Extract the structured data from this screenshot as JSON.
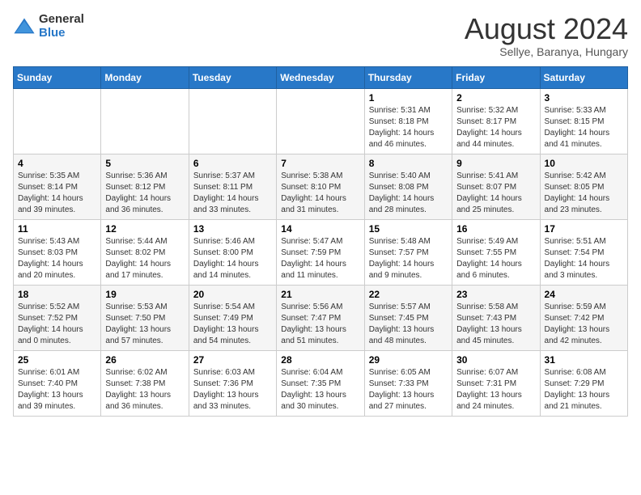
{
  "header": {
    "logo_general": "General",
    "logo_blue": "Blue",
    "title": "August 2024",
    "subtitle": "Sellye, Baranya, Hungary"
  },
  "calendar": {
    "days_of_week": [
      "Sunday",
      "Monday",
      "Tuesday",
      "Wednesday",
      "Thursday",
      "Friday",
      "Saturday"
    ],
    "weeks": [
      [
        {
          "day": "",
          "info": ""
        },
        {
          "day": "",
          "info": ""
        },
        {
          "day": "",
          "info": ""
        },
        {
          "day": "",
          "info": ""
        },
        {
          "day": "1",
          "info": "Sunrise: 5:31 AM\nSunset: 8:18 PM\nDaylight: 14 hours and 46 minutes."
        },
        {
          "day": "2",
          "info": "Sunrise: 5:32 AM\nSunset: 8:17 PM\nDaylight: 14 hours and 44 minutes."
        },
        {
          "day": "3",
          "info": "Sunrise: 5:33 AM\nSunset: 8:15 PM\nDaylight: 14 hours and 41 minutes."
        }
      ],
      [
        {
          "day": "4",
          "info": "Sunrise: 5:35 AM\nSunset: 8:14 PM\nDaylight: 14 hours and 39 minutes."
        },
        {
          "day": "5",
          "info": "Sunrise: 5:36 AM\nSunset: 8:12 PM\nDaylight: 14 hours and 36 minutes."
        },
        {
          "day": "6",
          "info": "Sunrise: 5:37 AM\nSunset: 8:11 PM\nDaylight: 14 hours and 33 minutes."
        },
        {
          "day": "7",
          "info": "Sunrise: 5:38 AM\nSunset: 8:10 PM\nDaylight: 14 hours and 31 minutes."
        },
        {
          "day": "8",
          "info": "Sunrise: 5:40 AM\nSunset: 8:08 PM\nDaylight: 14 hours and 28 minutes."
        },
        {
          "day": "9",
          "info": "Sunrise: 5:41 AM\nSunset: 8:07 PM\nDaylight: 14 hours and 25 minutes."
        },
        {
          "day": "10",
          "info": "Sunrise: 5:42 AM\nSunset: 8:05 PM\nDaylight: 14 hours and 23 minutes."
        }
      ],
      [
        {
          "day": "11",
          "info": "Sunrise: 5:43 AM\nSunset: 8:03 PM\nDaylight: 14 hours and 20 minutes."
        },
        {
          "day": "12",
          "info": "Sunrise: 5:44 AM\nSunset: 8:02 PM\nDaylight: 14 hours and 17 minutes."
        },
        {
          "day": "13",
          "info": "Sunrise: 5:46 AM\nSunset: 8:00 PM\nDaylight: 14 hours and 14 minutes."
        },
        {
          "day": "14",
          "info": "Sunrise: 5:47 AM\nSunset: 7:59 PM\nDaylight: 14 hours and 11 minutes."
        },
        {
          "day": "15",
          "info": "Sunrise: 5:48 AM\nSunset: 7:57 PM\nDaylight: 14 hours and 9 minutes."
        },
        {
          "day": "16",
          "info": "Sunrise: 5:49 AM\nSunset: 7:55 PM\nDaylight: 14 hours and 6 minutes."
        },
        {
          "day": "17",
          "info": "Sunrise: 5:51 AM\nSunset: 7:54 PM\nDaylight: 14 hours and 3 minutes."
        }
      ],
      [
        {
          "day": "18",
          "info": "Sunrise: 5:52 AM\nSunset: 7:52 PM\nDaylight: 14 hours and 0 minutes."
        },
        {
          "day": "19",
          "info": "Sunrise: 5:53 AM\nSunset: 7:50 PM\nDaylight: 13 hours and 57 minutes."
        },
        {
          "day": "20",
          "info": "Sunrise: 5:54 AM\nSunset: 7:49 PM\nDaylight: 13 hours and 54 minutes."
        },
        {
          "day": "21",
          "info": "Sunrise: 5:56 AM\nSunset: 7:47 PM\nDaylight: 13 hours and 51 minutes."
        },
        {
          "day": "22",
          "info": "Sunrise: 5:57 AM\nSunset: 7:45 PM\nDaylight: 13 hours and 48 minutes."
        },
        {
          "day": "23",
          "info": "Sunrise: 5:58 AM\nSunset: 7:43 PM\nDaylight: 13 hours and 45 minutes."
        },
        {
          "day": "24",
          "info": "Sunrise: 5:59 AM\nSunset: 7:42 PM\nDaylight: 13 hours and 42 minutes."
        }
      ],
      [
        {
          "day": "25",
          "info": "Sunrise: 6:01 AM\nSunset: 7:40 PM\nDaylight: 13 hours and 39 minutes."
        },
        {
          "day": "26",
          "info": "Sunrise: 6:02 AM\nSunset: 7:38 PM\nDaylight: 13 hours and 36 minutes."
        },
        {
          "day": "27",
          "info": "Sunrise: 6:03 AM\nSunset: 7:36 PM\nDaylight: 13 hours and 33 minutes."
        },
        {
          "day": "28",
          "info": "Sunrise: 6:04 AM\nSunset: 7:35 PM\nDaylight: 13 hours and 30 minutes."
        },
        {
          "day": "29",
          "info": "Sunrise: 6:05 AM\nSunset: 7:33 PM\nDaylight: 13 hours and 27 minutes."
        },
        {
          "day": "30",
          "info": "Sunrise: 6:07 AM\nSunset: 7:31 PM\nDaylight: 13 hours and 24 minutes."
        },
        {
          "day": "31",
          "info": "Sunrise: 6:08 AM\nSunset: 7:29 PM\nDaylight: 13 hours and 21 minutes."
        }
      ]
    ]
  }
}
